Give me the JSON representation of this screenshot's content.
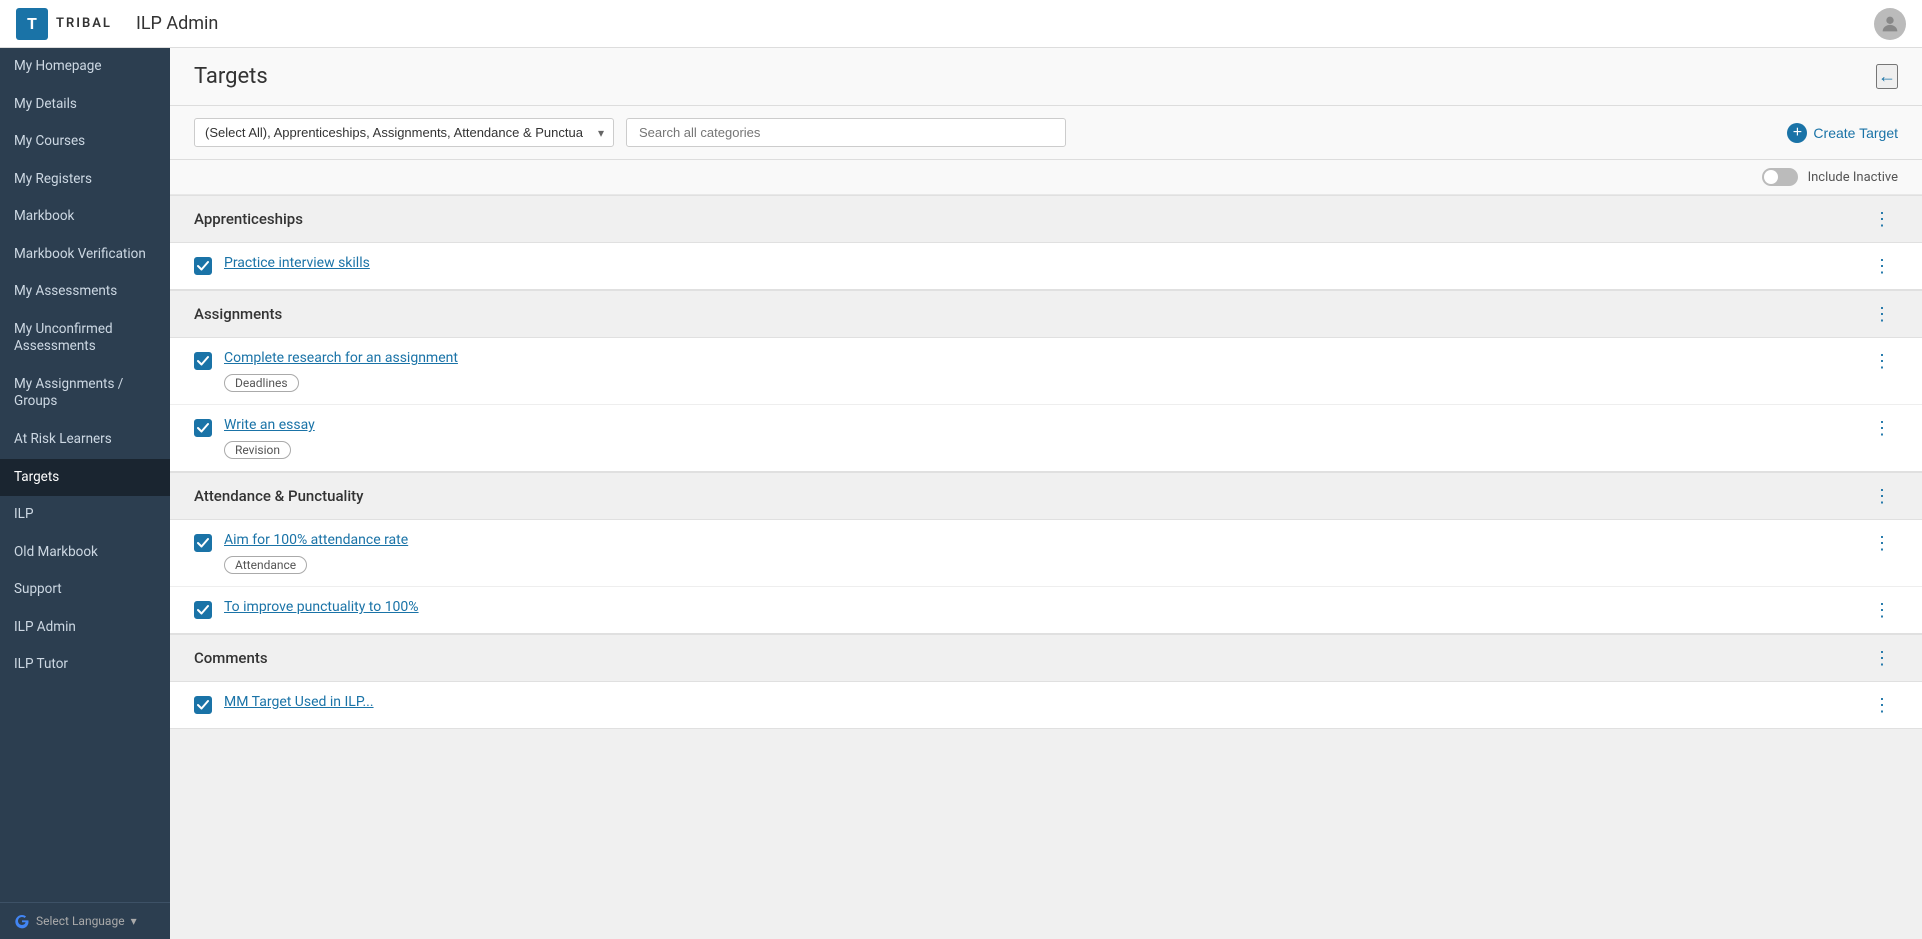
{
  "topbar": {
    "logo_letter": "T",
    "logo_word": "TRIBAL",
    "app_title": "ILP Admin"
  },
  "sidebar": {
    "items": [
      {
        "id": "my-homepage",
        "label": "My Homepage",
        "active": false
      },
      {
        "id": "my-details",
        "label": "My Details",
        "active": false
      },
      {
        "id": "my-courses",
        "label": "My Courses",
        "active": false
      },
      {
        "id": "my-registers",
        "label": "My Registers",
        "active": false
      },
      {
        "id": "markbook",
        "label": "Markbook",
        "active": false
      },
      {
        "id": "markbook-verification",
        "label": "Markbook Verification",
        "active": false
      },
      {
        "id": "my-assessments",
        "label": "My Assessments",
        "active": false
      },
      {
        "id": "my-unconfirmed-assessments",
        "label": "My Unconfirmed Assessments",
        "active": false
      },
      {
        "id": "my-assignments-groups",
        "label": "My Assignments / Groups",
        "active": false
      },
      {
        "id": "at-risk-learners",
        "label": "At Risk Learners",
        "active": false
      },
      {
        "id": "targets",
        "label": "Targets",
        "active": true
      },
      {
        "id": "ilp",
        "label": "ILP",
        "active": false
      },
      {
        "id": "old-markbook",
        "label": "Old Markbook",
        "active": false
      },
      {
        "id": "support",
        "label": "Support",
        "active": false
      },
      {
        "id": "ilp-admin",
        "label": "ILP Admin",
        "active": false
      },
      {
        "id": "ilp-tutor",
        "label": "ILP Tutor",
        "active": false
      }
    ],
    "footer": {
      "label": "Select Language",
      "chevron": "▾"
    }
  },
  "page": {
    "title": "Targets",
    "back_icon": "←",
    "filter_value": "(Select All), Apprenticeships, Assignments, Attendance & Punctuality, Comments....",
    "search_placeholder": "Search all categories",
    "create_target_label": "Create Target",
    "include_inactive_label": "Include Inactive",
    "categories": [
      {
        "id": "apprenticeships",
        "name": "Apprenticeships",
        "items": [
          {
            "id": "practice-interview-skills",
            "label": "Practice interview skills",
            "checked": true,
            "tags": []
          }
        ]
      },
      {
        "id": "assignments",
        "name": "Assignments",
        "items": [
          {
            "id": "complete-research",
            "label": "Complete research for an assignment",
            "checked": true,
            "tags": [
              "Deadlines"
            ]
          },
          {
            "id": "write-essay",
            "label": "Write an essay",
            "checked": true,
            "tags": [
              "Revision"
            ]
          }
        ]
      },
      {
        "id": "attendance-punctuality",
        "name": "Attendance & Punctuality",
        "items": [
          {
            "id": "aim-attendance",
            "label": "Aim for 100% attendance rate",
            "checked": true,
            "tags": [
              "Attendance"
            ]
          },
          {
            "id": "improve-punctuality",
            "label": "To improve punctuality to 100%",
            "checked": true,
            "tags": []
          }
        ]
      },
      {
        "id": "comments",
        "name": "Comments",
        "items": [
          {
            "id": "mm-target",
            "label": "MM Target Used in ILP...",
            "checked": true,
            "tags": []
          }
        ]
      }
    ]
  }
}
